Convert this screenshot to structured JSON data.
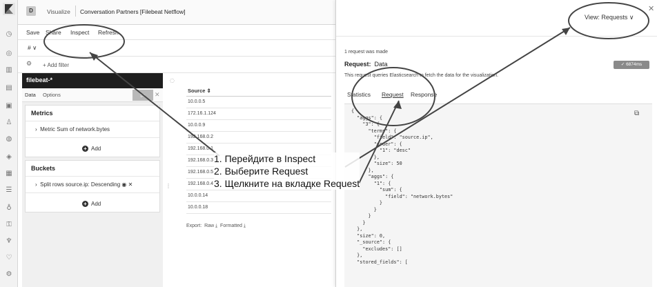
{
  "header": {
    "avatar_letter": "D",
    "breadcrumb_parent": "Visualize",
    "breadcrumb_current": "Conversation Partners [Filebeat Netflow]"
  },
  "menu": {
    "save": "Save",
    "share": "Share",
    "inspect": "Inspect",
    "refresh": "Refresh"
  },
  "query": {
    "language_toggle": "# ∨"
  },
  "filters": {
    "add_filter": "+ Add filter"
  },
  "editor": {
    "index_pattern": "filebeat-*",
    "tab_data": "Data",
    "tab_options": "Options",
    "metrics_title": "Metrics",
    "metric_item": "Metric Sum of network.bytes",
    "metrics_add": "Add",
    "buckets_title": "Buckets",
    "bucket_item": "Split rows source.ip: Descending",
    "buckets_add": "Add"
  },
  "table": {
    "column": "Source",
    "rows": [
      "10.0.0.5",
      "172.16.1.124",
      "10.0.0.9",
      "192.168.0.2",
      "192.168.0.1",
      "192.168.0.3",
      "192.168.0.5",
      "192.168.0.4",
      "10.0.0.14",
      "10.0.0.18"
    ],
    "export_label": "Export:",
    "export_raw": "Raw",
    "export_formatted": "Formatted"
  },
  "inspect": {
    "view_selector": "View: Requests",
    "requests_made": "1 request was made",
    "request_label": "Request:",
    "request_name": "Data",
    "duration": "6874ms",
    "description": "This request queries Elasticsearch to fetch the data for the visualization.",
    "tabs": [
      "Statistics",
      "Request",
      "Response"
    ],
    "active_tab": "Request",
    "code": "{\n  \"aggs\": {\n    \"3\": {\n      \"terms\": {\n        \"field\": \"source.ip\",\n        \"order\": {\n          \"1\": \"desc\"\n        },\n        \"size\": 50\n      },\n      \"aggs\": {\n        \"1\": {\n          \"sum\": {\n            \"field\": \"network.bytes\"\n          }\n        }\n      }\n    }\n  },\n  \"size\": 0,\n  \"_source\": {\n    \"excludes\": []\n  },\n  \"stored_fields\": ["
  },
  "annotation": {
    "step1": "1. Перейдите в Inspect",
    "step2": "2. Выберите Request",
    "step3": "3. Щелкните на вкладке Request"
  }
}
